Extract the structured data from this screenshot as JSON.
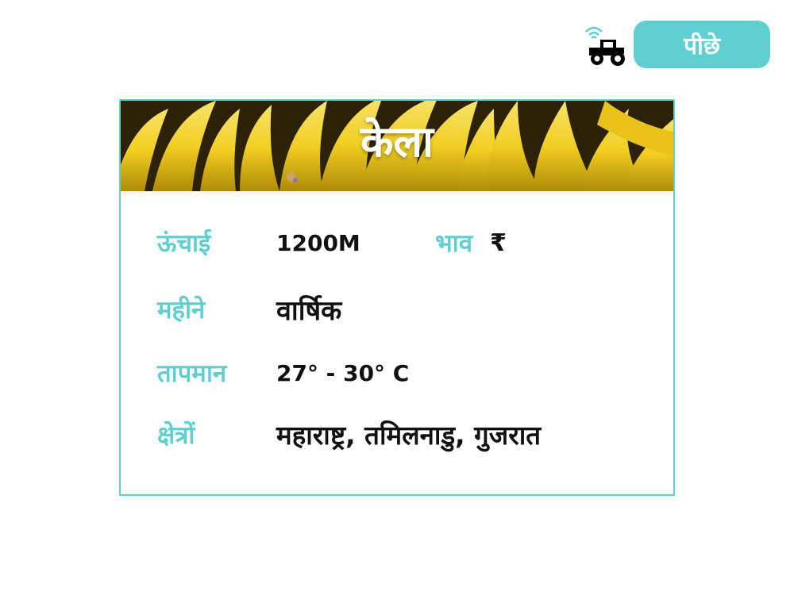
{
  "header": {
    "back_label": "पीछे",
    "tractor_icon": "tractor-wifi-icon"
  },
  "crop": {
    "title": "केला",
    "banner_image": "bananas-photo",
    "height_label": "ऊंचाई",
    "height_value": "1200M",
    "price_label": "भाव",
    "price_value": "₹",
    "months_label": "महीने",
    "months_value": "वार्षिक",
    "temperature_label": "तापमान",
    "temperature_value": "27° - 30° C",
    "regions_label": "क्षेत्रों",
    "regions_value": "महाराष्ट्र, तमिलनाडु, गुजरात"
  },
  "colors": {
    "accent": "#5fcfcf",
    "text": "#111111",
    "background": "#ffffff"
  }
}
